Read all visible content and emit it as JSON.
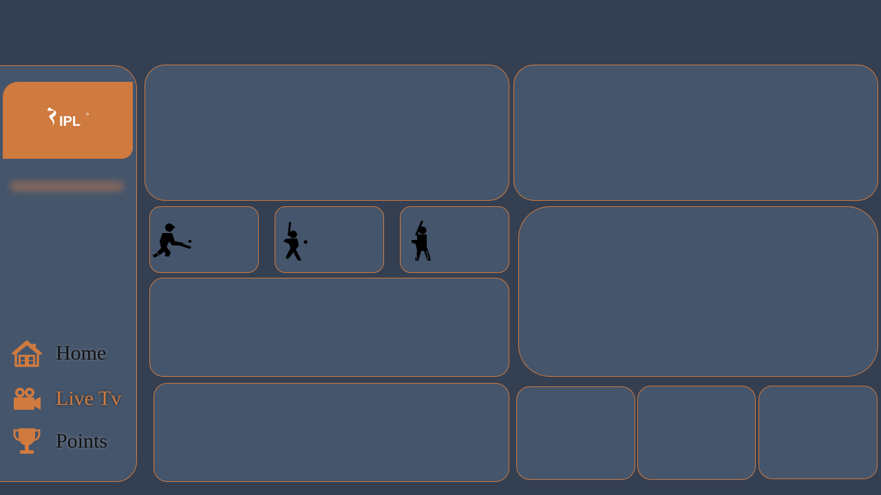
{
  "brand": {
    "logo_text": "IPL",
    "accent_color": "#cf7a3f",
    "panel_color": "#45556b",
    "background_color": "#343f52"
  },
  "sidebar": {
    "nav": [
      {
        "label": "Home",
        "icon": "home-icon",
        "active": false
      },
      {
        "label": "Live Tv",
        "icon": "video-camera-icon",
        "active": true
      },
      {
        "label": "Points",
        "icon": "trophy-icon",
        "active": false
      }
    ]
  },
  "tiles": {
    "batting_icons": [
      "batter-sweep-icon",
      "batter-stance-icon",
      "batter-ready-icon"
    ]
  }
}
